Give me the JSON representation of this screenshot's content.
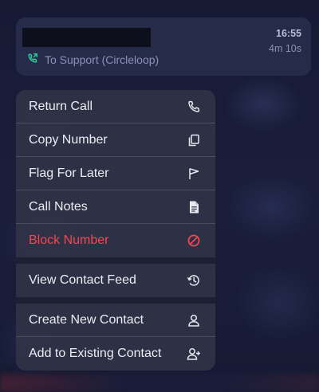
{
  "call": {
    "time": "16:55",
    "duration": "4m 10s",
    "direction_label": "To Support (Circleloop)"
  },
  "menu": {
    "group1": [
      {
        "label": "Return Call",
        "icon": "phone-icon"
      },
      {
        "label": "Copy Number",
        "icon": "copy-icon"
      },
      {
        "label": "Flag For Later",
        "icon": "flag-icon"
      },
      {
        "label": "Call Notes",
        "icon": "document-icon"
      },
      {
        "label": "Block Number",
        "icon": "block-icon"
      }
    ],
    "group2": [
      {
        "label": "View Contact Feed",
        "icon": "history-icon"
      }
    ],
    "group3": [
      {
        "label": "Create New Contact",
        "icon": "person-icon"
      },
      {
        "label": "Add to Existing Contact",
        "icon": "person-add-icon"
      }
    ]
  },
  "colors": {
    "danger": "#ef4a52",
    "accent_green": "#2ecc9a"
  }
}
